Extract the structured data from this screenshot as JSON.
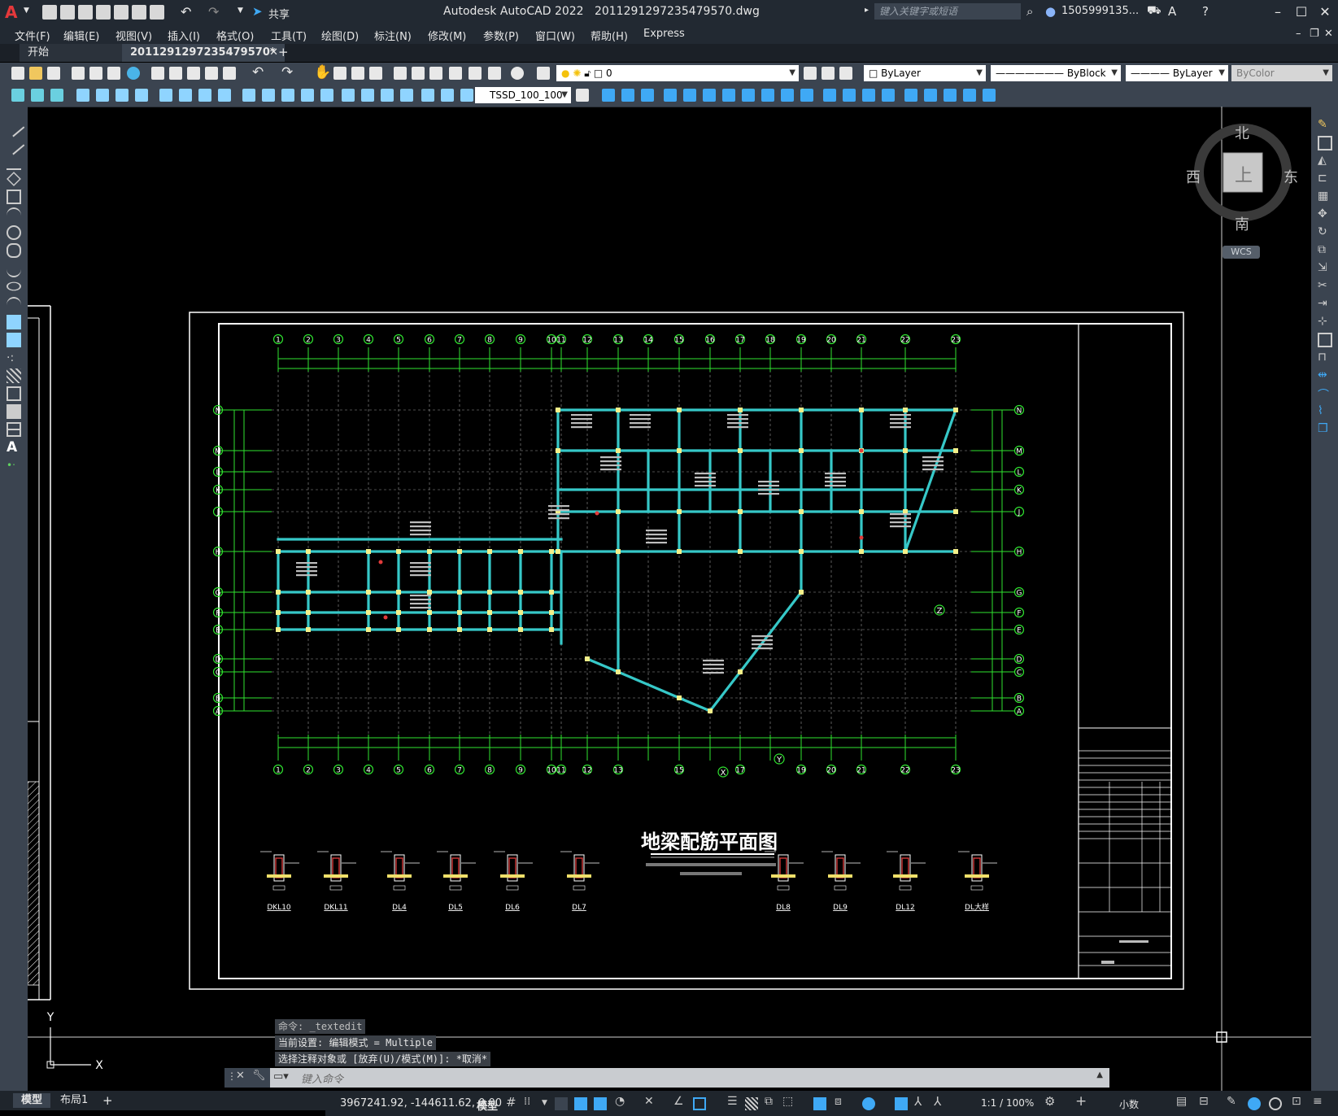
{
  "titlebar": {
    "app_name": "Autodesk AutoCAD 2022",
    "filename": "201129129723547​9570.dwg",
    "share_label": "共享",
    "search_placeholder": "键入关键字或短语",
    "user": "1505999135...",
    "logo_letter": "A"
  },
  "menubar": {
    "items": [
      "文件(F)",
      "编辑(E)",
      "视图(V)",
      "插入(I)",
      "格式(O)",
      "工具(T)",
      "绘图(D)",
      "标注(N)",
      "修改(M)",
      "参数(P)",
      "窗口(W)",
      "帮助(H)",
      "Express"
    ]
  },
  "tabs": {
    "start": "开始",
    "document": "201129129723547​9570*"
  },
  "toolbar": {
    "layer_value": "0",
    "color_value": "ByLayer",
    "linetype_value": "ByBlock",
    "lineweight_value": "ByLayer",
    "plotstyle_value": "ByColor",
    "textstyle_value": "TSSD_100_100"
  },
  "viewcube": {
    "north": "北",
    "south": "南",
    "east": "东",
    "west": "西",
    "top_face": "上",
    "wcs": "WCS"
  },
  "drawing": {
    "title": "地梁配筋平面图",
    "col_labels_top": [
      "1",
      "2",
      "3",
      "4",
      "5",
      "6",
      "7",
      "8",
      "9",
      "10",
      "11",
      "12",
      "13",
      "14",
      "15",
      "16",
      "17",
      "18",
      "19",
      "20",
      "21",
      "22",
      "23"
    ],
    "col_labels_bottom": [
      "1",
      "2",
      "3",
      "4",
      "5",
      "6",
      "7",
      "8",
      "9",
      "10",
      "11",
      "12",
      "13",
      "15",
      "17",
      "19",
      "20",
      "21",
      "22",
      "23"
    ],
    "row_labels": [
      "N",
      "M",
      "L",
      "K",
      "J",
      "H",
      "G",
      "F",
      "E",
      "D",
      "C",
      "B",
      "A"
    ],
    "section_labels": [
      "DKL10",
      "DKL11",
      "DL4",
      "DL5",
      "DL6",
      "DL7",
      "DL8",
      "DL9",
      "DL12",
      "DL大样"
    ],
    "axis_x": "X",
    "axis_y": "Y",
    "axis_z": "Z",
    "ucs_x": "X",
    "ucs_y": "Y"
  },
  "command": {
    "history": [
      "命令: _textedit",
      "当前设置: 编辑模式 = Multiple",
      "选择注释对象或 [放弃(U)/模式(M)]: *取消*"
    ],
    "placeholder": "键入命令"
  },
  "layout_tabs": [
    "模型",
    "布局1"
  ],
  "status": {
    "coordinates": "3967241.92, -144611.62, 0.00",
    "space": "模型",
    "scale": "1:1 / 100%",
    "units": "小数"
  },
  "colors": {
    "titlebar": "#222932",
    "toolbar": "#3b4450",
    "canvas": "#000000",
    "grid_green": "#2fe32f",
    "beam_cyan": "#36c8c8",
    "frame_white": "#ffffff"
  }
}
